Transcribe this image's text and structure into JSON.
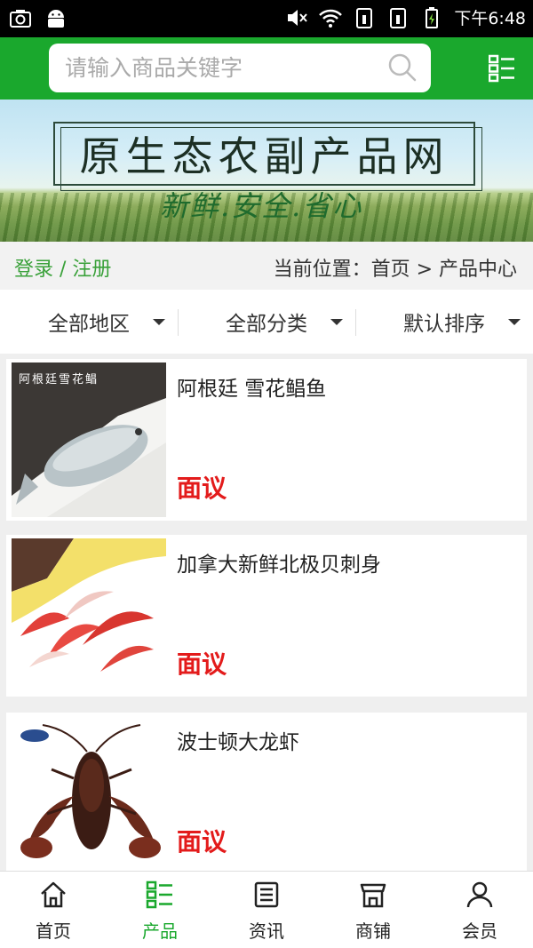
{
  "status_bar": {
    "time": "下午6:48",
    "icons": [
      "camera-icon",
      "android-icon",
      "mute-icon",
      "wifi-icon",
      "sim1-icon",
      "sim2-icon",
      "battery-icon"
    ]
  },
  "search": {
    "placeholder": "请输入商品关键字",
    "value": ""
  },
  "banner": {
    "title": "原生态农副产品网",
    "slogan": "新鲜.安全.省心"
  },
  "location": {
    "login": "登录 / 注册",
    "breadcrumb": "当前位置：首页 > 产品中心"
  },
  "filters": [
    {
      "label": "全部地区"
    },
    {
      "label": "全部分类"
    },
    {
      "label": "默认排序"
    }
  ],
  "products": [
    {
      "name": "阿根廷 雪花鲳鱼",
      "price": "面议",
      "image_caption": "阿根廷雪花鲳"
    },
    {
      "name": "加拿大新鲜北极贝刺身",
      "price": "面议"
    },
    {
      "name": "波士顿大龙虾",
      "price": "面议"
    }
  ],
  "bottom_nav": [
    {
      "label": "首页",
      "icon": "home-icon"
    },
    {
      "label": "产品",
      "icon": "list-icon"
    },
    {
      "label": "资讯",
      "icon": "news-icon"
    },
    {
      "label": "商铺",
      "icon": "shop-icon"
    },
    {
      "label": "会员",
      "icon": "user-icon"
    }
  ],
  "colors": {
    "brand_green": "#1aa82d",
    "price_red": "#e31b1b",
    "login_green": "#3aa13a"
  }
}
